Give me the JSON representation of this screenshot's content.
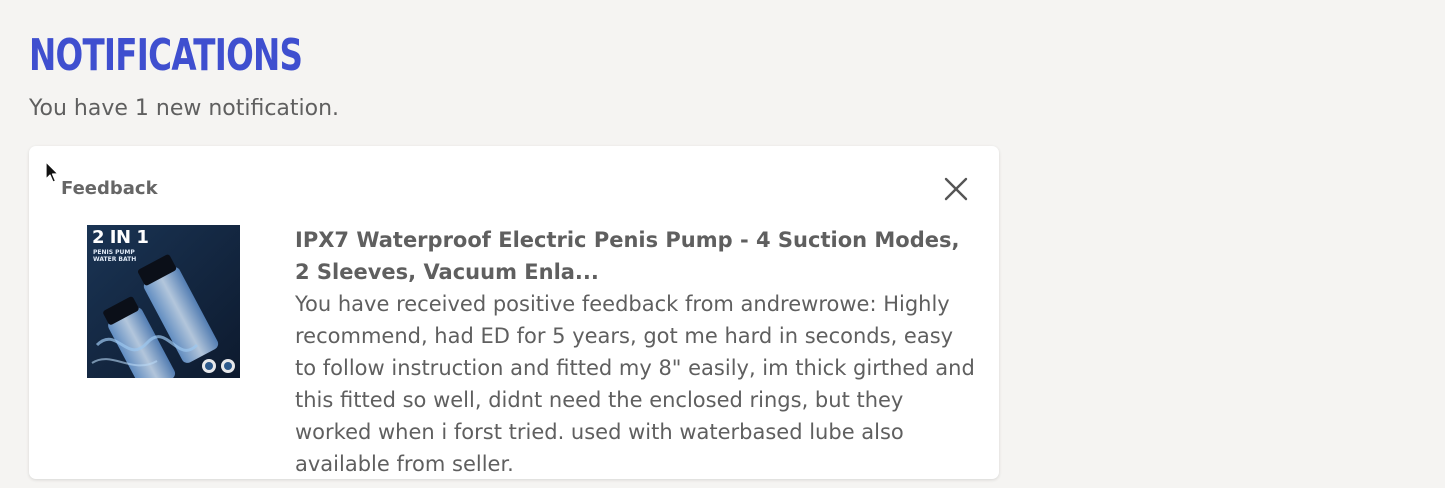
{
  "header": {
    "title": "NOTIFICATIONS",
    "subtitle": "You have 1 new notification."
  },
  "notification": {
    "category": "Feedback",
    "product_title": "IPX7 Waterproof Electric Penis Pump - 4 Suction Modes, 2 Sleeves, Vacuum Enla...",
    "message": "You have received positive feedback from andrewrowe: Highly recommend, had ED for 5 years, got me hard in seconds, easy to follow instruction and fitted my 8\" easily, im thick girthed and this fitted so well, didnt need the enclosed rings, but they worked when i forst tried. used with waterbased lube also available from seller.",
    "image_text_main": "2 IN 1",
    "image_text_sub": "PENIS PUMP WATER BATH",
    "close_icon": "close-icon"
  },
  "colors": {
    "title": "#3f4fcf",
    "text": "#5f5f5f",
    "background": "#f5f4f2",
    "card": "#ffffff"
  }
}
